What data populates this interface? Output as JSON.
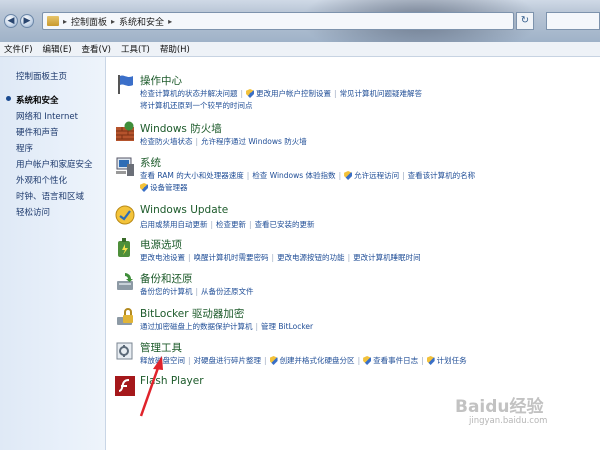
{
  "address_bar": {
    "crumbs": [
      "控制面板",
      "系统和安全"
    ]
  },
  "menu": [
    "文件(F)",
    "编辑(E)",
    "查看(V)",
    "工具(T)",
    "帮助(H)"
  ],
  "sidebar": {
    "home": "控制面板主页",
    "items": [
      {
        "label": "系统和安全",
        "active": true
      },
      {
        "label": "网络和 Internet"
      },
      {
        "label": "硬件和声音"
      },
      {
        "label": "程序"
      },
      {
        "label": "用户帐户和家庭安全"
      },
      {
        "label": "外观和个性化"
      },
      {
        "label": "时钟、语言和区域"
      },
      {
        "label": "轻松访问"
      }
    ]
  },
  "categories": [
    {
      "title": "操作中心",
      "lines": [
        [
          "检查计算机的状态并解决问题",
          "更改用户帐户控制设置",
          "常见计算机问题疑难解答"
        ],
        [
          "将计算机还原到一个较早的时间点"
        ]
      ]
    },
    {
      "title": "Windows 防火墙",
      "lines": [
        [
          "检查防火墙状态",
          "允许程序通过 Windows 防火墙"
        ]
      ]
    },
    {
      "title": "系统",
      "lines": [
        [
          "查看 RAM 的大小和处理器速度",
          "检查 Windows 体验指数",
          "允许远程访问",
          "查看该计算机的名称"
        ],
        [
          "设备管理器"
        ]
      ]
    },
    {
      "title": "Windows Update",
      "lines": [
        [
          "启用或禁用自动更新",
          "检查更新",
          "查看已安装的更新"
        ]
      ]
    },
    {
      "title": "电源选项",
      "lines": [
        [
          "更改电池设置",
          "唤醒计算机时需要密码",
          "更改电源按钮的功能",
          "更改计算机睡眠时间"
        ]
      ]
    },
    {
      "title": "备份和还原",
      "lines": [
        [
          "备份您的计算机",
          "从备份还原文件"
        ]
      ]
    },
    {
      "title": "BitLocker 驱动器加密",
      "lines": [
        [
          "通过加密磁盘上的数据保护计算机",
          "管理 BitLocker"
        ]
      ]
    },
    {
      "title": "管理工具",
      "lines": [
        [
          "释放磁盘空间",
          "对硬盘进行碎片整理",
          "创建并格式化硬盘分区",
          "查看事件日志",
          "计划任务"
        ]
      ]
    },
    {
      "title": "Flash Player",
      "lines": []
    }
  ],
  "watermark": {
    "brand": "Baidu经验",
    "url": "jingyan.baidu.com"
  },
  "colors": {
    "link": "#1f4d96",
    "category_title": "#1c5a2a",
    "annotation_arrow": "#e0232b"
  },
  "icons": [
    "control-panel-icon",
    "action-center-flag-icon",
    "firewall-icon",
    "system-icon",
    "windows-update-icon",
    "power-options-icon",
    "backup-restore-icon",
    "bitlocker-icon",
    "admin-tools-icon",
    "flash-player-icon",
    "uac-shield-icon"
  ]
}
